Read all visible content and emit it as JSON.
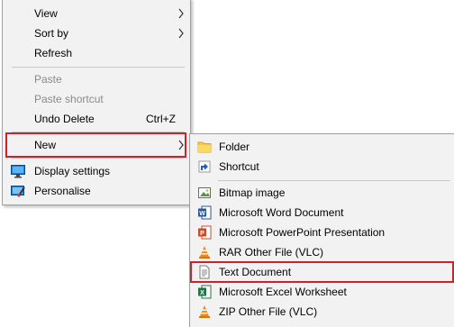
{
  "context_menu": {
    "view": "View",
    "sort_by": "Sort by",
    "refresh": "Refresh",
    "paste": "Paste",
    "paste_shortcut": "Paste shortcut",
    "undo_delete": "Undo Delete",
    "undo_delete_shortcut": "Ctrl+Z",
    "new": "New",
    "display_settings": "Display settings",
    "personalise": "Personalise"
  },
  "submenu_new": {
    "folder": "Folder",
    "shortcut": "Shortcut",
    "bitmap": "Bitmap image",
    "word": "Microsoft Word Document",
    "powerpoint": "Microsoft PowerPoint Presentation",
    "rar": "RAR Other File (VLC)",
    "text": "Text Document",
    "excel": "Microsoft Excel Worksheet",
    "zip": "ZIP Other File (VLC)"
  },
  "colors": {
    "highlight_border": "#d0202a",
    "menu_bg": "#f2f2f2"
  }
}
